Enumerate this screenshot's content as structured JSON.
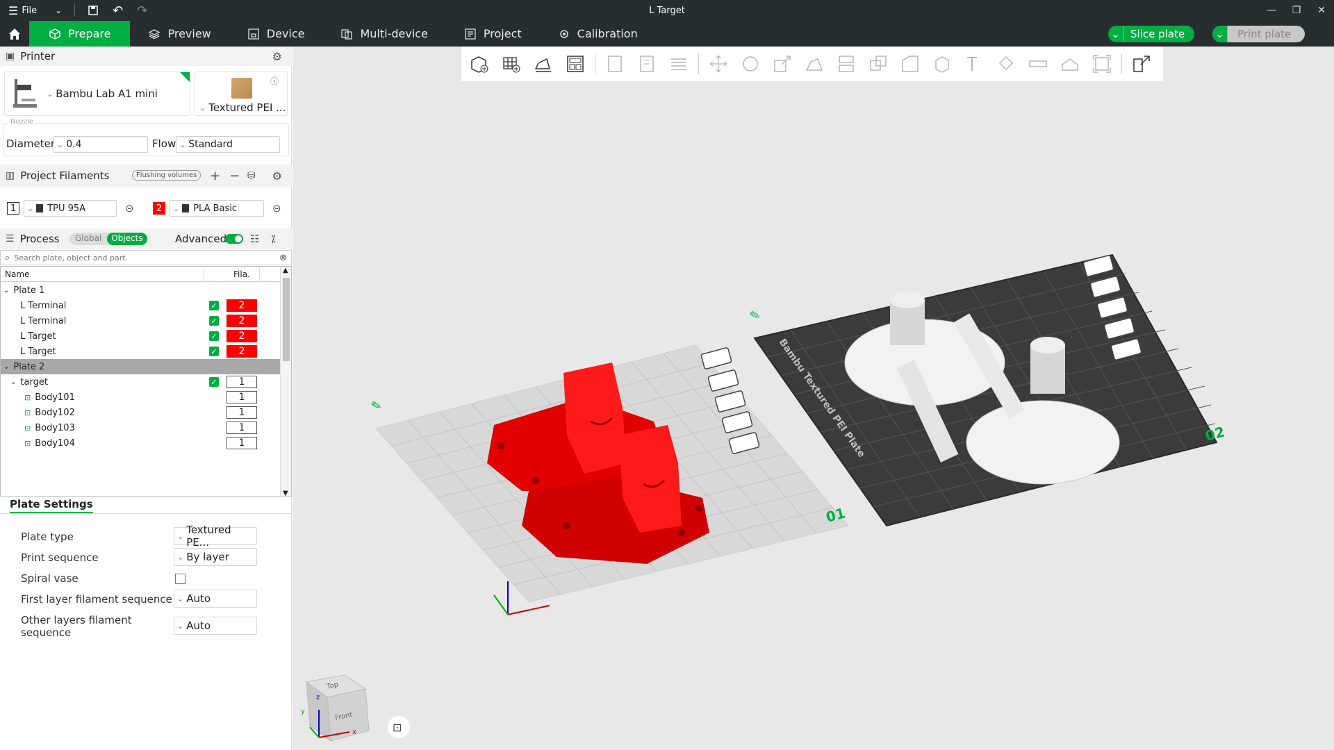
{
  "window": {
    "title": "L Target",
    "file_menu": "File"
  },
  "tabs": [
    {
      "label": "Prepare"
    },
    {
      "label": "Preview"
    },
    {
      "label": "Device"
    },
    {
      "label": "Multi-device"
    },
    {
      "label": "Project"
    },
    {
      "label": "Calibration"
    }
  ],
  "actions": {
    "slice_label": "Slice plate",
    "print_label": "Print plate"
  },
  "colors": {
    "accent": "#00ae42",
    "titlebar": "#262e30",
    "filament_red": "#ff0000"
  },
  "printer": {
    "section_label": "Printer",
    "name": "Bambu Lab A1 mini",
    "plate": "Textured PEI ...",
    "nozzle_label": "Nozzle",
    "diameter_label": "Diameter",
    "diameter_value": "0.4",
    "flow_label": "Flow",
    "flow_value": "Standard"
  },
  "filaments": {
    "section_label": "Project Filaments",
    "flushing_label": "Flushing volumes",
    "items": [
      {
        "index": "1",
        "name": "TPU 95A"
      },
      {
        "index": "2",
        "name": "PLA Basic"
      }
    ]
  },
  "process": {
    "section_label": "Process",
    "global_label": "Global",
    "objects_label": "Objects",
    "advanced_label": "Advanced",
    "search_placeholder": "Search plate, object and part."
  },
  "object_tree": {
    "col_name": "Name",
    "col_fila": "Fila.",
    "rows": [
      {
        "label": "Plate 1"
      },
      {
        "label": "L Terminal",
        "fila": "2"
      },
      {
        "label": "L Terminal",
        "fila": "2"
      },
      {
        "label": "L Target",
        "fila": "2"
      },
      {
        "label": "L Target",
        "fila": "2"
      },
      {
        "label": "Plate 2"
      },
      {
        "label": "target",
        "fila": "1"
      },
      {
        "label": "Body101",
        "fila": "1"
      },
      {
        "label": "Body102",
        "fila": "1"
      },
      {
        "label": "Body103",
        "fila": "1"
      },
      {
        "label": "Body104",
        "fila": "1"
      }
    ]
  },
  "plate_settings": {
    "tab_label": "Plate Settings",
    "plate_type_label": "Plate type",
    "plate_type_value": "Textured PE...",
    "print_sequence_label": "Print sequence",
    "print_sequence_value": "By layer",
    "spiral_label": "Spiral vase",
    "first_layer_label": "First layer filament sequence",
    "first_layer_value": "Auto",
    "other_layers_label": "Other layers filament sequence",
    "other_layers_value": "Auto"
  },
  "viewport": {
    "plate1_number": "01",
    "plate2_number": "02",
    "plate2_brand": "Bambu Textured PEI Plate",
    "cube_top": "Top",
    "cube_front": "Front",
    "axis_x": "x",
    "axis_y": "y",
    "axis_z": "z"
  }
}
